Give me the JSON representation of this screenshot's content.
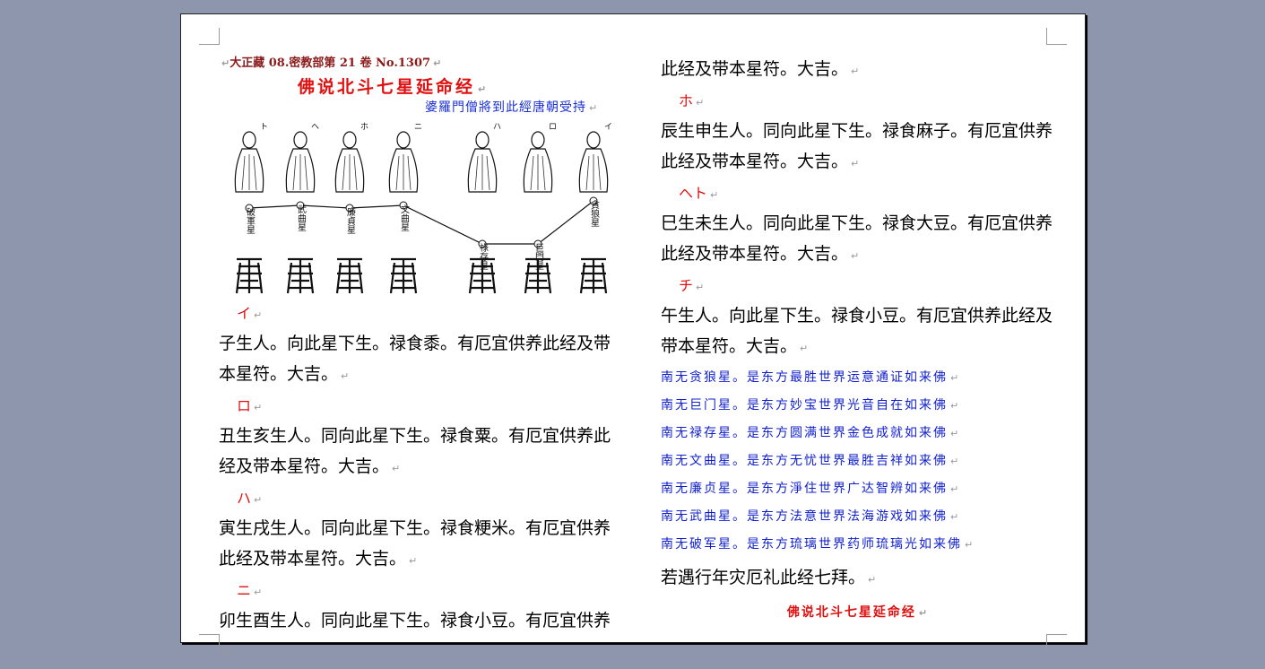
{
  "document": {
    "source": "大正藏 08.密教部第 21 卷 No.1307",
    "title": "佛说北斗七星延命经",
    "translator": "婆羅門僧將到此經唐朝受持",
    "para_mark": "↵",
    "figure": {
      "stars": [
        "破軍星",
        "武曲星",
        "廉貞星",
        "文曲星",
        "祿存星",
        "巨門星",
        "貪狼星"
      ],
      "marks": [
        "ト",
        "ヘ",
        "ホ",
        "ニ",
        "ハ",
        "ロ",
        "イ"
      ]
    },
    "left_column": [
      {
        "label": "イ",
        "text": "子生人。向此星下生。禄食黍。有厄宜供养此经及带本星符。大吉。"
      },
      {
        "label": "ロ",
        "text": "丑生亥生人。同向此星下生。禄食粟。有厄宜供养此经及带本星符。大吉。"
      },
      {
        "label": "ハ",
        "text": "寅生戌生人。同向此星下生。禄食粳米。有厄宜供养此经及带本星符。大吉。"
      },
      {
        "label": "ニ",
        "text": "卯生酉生人。同向此星下生。禄食小豆。有厄宜供养"
      }
    ],
    "right_column_start": "此经及带本星符。大吉。",
    "right_column": [
      {
        "label": "ホ",
        "text": "辰生申生人。同向此星下生。禄食麻子。有厄宜供养此经及带本星符。大吉。"
      },
      {
        "label": "ヘト",
        "text": "巳生未生人。同向此星下生。禄食大豆。有厄宜供养此经及带本星符。大吉。"
      },
      {
        "label": "チ",
        "text": "午生人。向此星下生。禄食小豆。有厄宜供养此经及带本星符。大吉。"
      }
    ],
    "buddhas": [
      "南无贪狼星。是东方最胜世界运意通证如来佛",
      "南无巨门星。是东方妙宝世界光音自在如来佛",
      "南无禄存星。是东方圆满世界金色成就如来佛",
      "南无文曲星。是东方无忧世界最胜吉祥如来佛",
      "南无廉贞星。是东方淨住世界广达智辨如来佛",
      "南无武曲星。是东方法意世界法海游戏如来佛",
      "南无破军星。是东方琉璃世界药师琉璃光如来佛"
    ],
    "closing": "若遇行年灾厄礼此经七拜。",
    "footer_title": "佛说北斗七星延命经",
    "colors": {
      "red": "#e01010",
      "blue": "#1a2fd6",
      "brown": "#8b1a1a",
      "background": "#8e96ad"
    }
  }
}
